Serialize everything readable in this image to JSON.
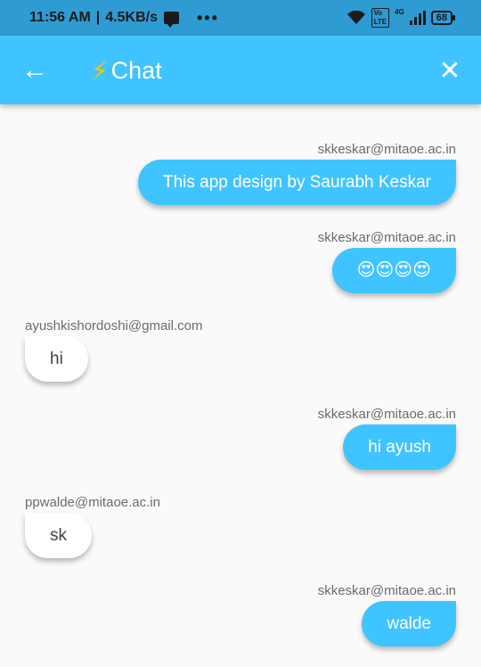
{
  "status_bar": {
    "time": "11:56 AM",
    "speed": "4.5KB/s",
    "dots": "•••",
    "network": "4G",
    "battery": "68"
  },
  "app_bar": {
    "back_icon": "←",
    "bolt_icon": "⚡",
    "title": "Chat",
    "close_icon": "✕"
  },
  "messages": [
    {
      "sender": "skkeskar@mitaoe.ac.in",
      "text": "This app design by Saurabh Keskar",
      "direction": "sent"
    },
    {
      "sender": "skkeskar@mitaoe.ac.in",
      "text": "😍😍😍😍",
      "direction": "sent"
    },
    {
      "sender": "ayushkishordoshi@gmail.com",
      "text": "hi",
      "direction": "received"
    },
    {
      "sender": "skkeskar@mitaoe.ac.in",
      "text": "hi ayush",
      "direction": "sent"
    },
    {
      "sender": "ppwalde@mitaoe.ac.in",
      "text": "sk",
      "direction": "received"
    },
    {
      "sender": "skkeskar@mitaoe.ac.in",
      "text": "walde",
      "direction": "sent"
    }
  ],
  "colors": {
    "app_bar": "#40c4ff",
    "status_bar": "#2e9bd3",
    "sent_bubble": "#40c4ff",
    "received_bubble": "#ffffff",
    "background": "#fafafa"
  }
}
